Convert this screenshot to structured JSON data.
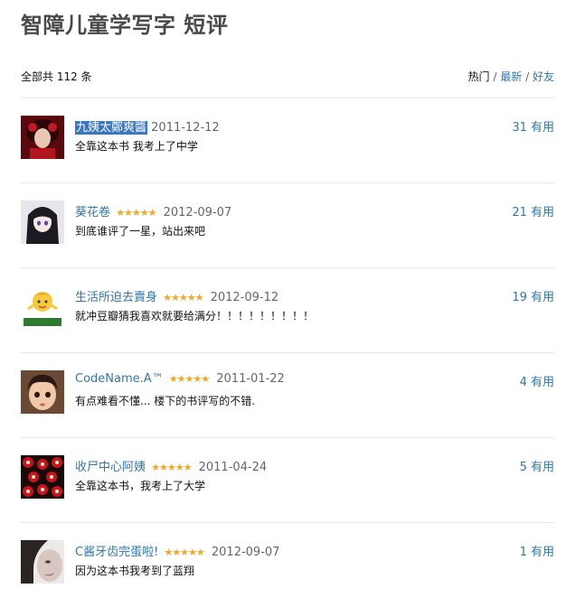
{
  "page": {
    "title": "智障儿童学写字 短评",
    "total": "全部共 112 条",
    "sort": {
      "hot": "热门",
      "newest": "最新",
      "friends": "好友",
      "separator": "/"
    }
  },
  "reviews": [
    {
      "user": "九姨太鄭爽醬",
      "stars": "",
      "date": "2011-12-12",
      "votes": "31 有用",
      "comment": "全靠这本书 我考上了中学",
      "avatar": "portrait-red-hair"
    },
    {
      "user": "葵花卷",
      "stars": "★★★★★",
      "date": "2012-09-07",
      "votes": "21 有用",
      "comment": "到底谁评了一星，站出来吧",
      "avatar": "anime-girl"
    },
    {
      "user": "生活所迫去賣身",
      "stars": "★★★★★",
      "date": "2012-09-12",
      "votes": "19 有用",
      "comment": "就冲豆瓣猜我喜欢就要给满分！！！！！！！！！",
      "avatar": "emoji-shrug"
    },
    {
      "user": "CodeName.A™",
      "stars": "★★★★★",
      "date": "2011-01-22",
      "votes": "4 有用",
      "comment": "有点难看不懂... 楼下的书评写的不错.",
      "avatar": "child-face"
    },
    {
      "user": "收尸中心阿姨",
      "stars": "★★★★★",
      "date": "2011-04-24",
      "votes": "5 有用",
      "comment": "全靠这本书，我考上了大学",
      "avatar": "red-pattern"
    },
    {
      "user": "C酱牙齿完蛋啦!",
      "stars": "★★★★★",
      "date": "2012-09-07",
      "votes": "1 有用",
      "comment": "因为这本书我考到了蓝翔",
      "avatar": "woman-face"
    }
  ]
}
